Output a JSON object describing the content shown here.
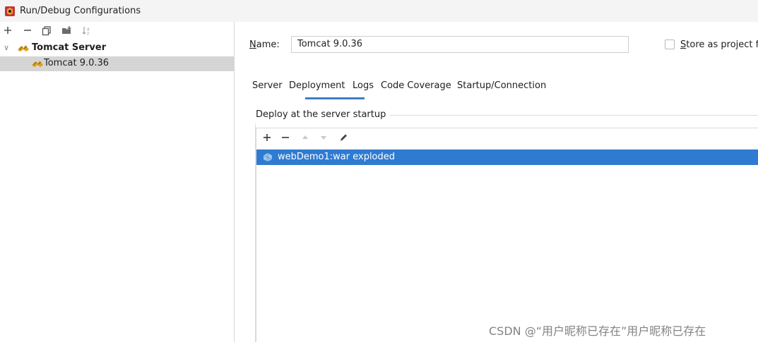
{
  "window": {
    "title": "Run/Debug Configurations"
  },
  "left_toolbar": {
    "icons": [
      "add-icon",
      "remove-icon",
      "copy-icon",
      "move-into-folder-icon",
      "sort-icon"
    ]
  },
  "tree": {
    "parent": {
      "label": "Tomcat Server",
      "icon": "tomcat-icon",
      "expanded": true
    },
    "children": [
      {
        "label": "Tomcat 9.0.36",
        "icon": "tomcat-icon",
        "selected": true
      }
    ]
  },
  "config": {
    "name_label_mnemonic": "N",
    "name_label_rest": "ame:",
    "name_value": "Tomcat 9.0.36",
    "store_label_mnemonic": "S",
    "store_label_rest": "tore as project fi",
    "store_checked": false
  },
  "tabs": [
    {
      "label": "Server",
      "active": false
    },
    {
      "label": "Deployment",
      "active": true
    },
    {
      "label": "Logs",
      "active": false
    },
    {
      "label": "Code Coverage",
      "active": false
    },
    {
      "label": "Startup/Connection",
      "active": false
    }
  ],
  "deployment": {
    "group_title": "Deploy at the server startup",
    "toolbar_icons": [
      "add-icon",
      "remove-icon",
      "move-up-icon",
      "move-down-icon",
      "edit-icon"
    ],
    "artifacts": [
      {
        "label": "webDemo1:war exploded",
        "icon": "artifact-icon",
        "selected": true
      }
    ]
  },
  "watermark": "CSDN @“用户昵称已存在”用户昵称已存在",
  "colors": {
    "selection": "#2f7bd1",
    "tab_underline": "#3c7fc8",
    "tree_selection": "#d5d5d5"
  }
}
